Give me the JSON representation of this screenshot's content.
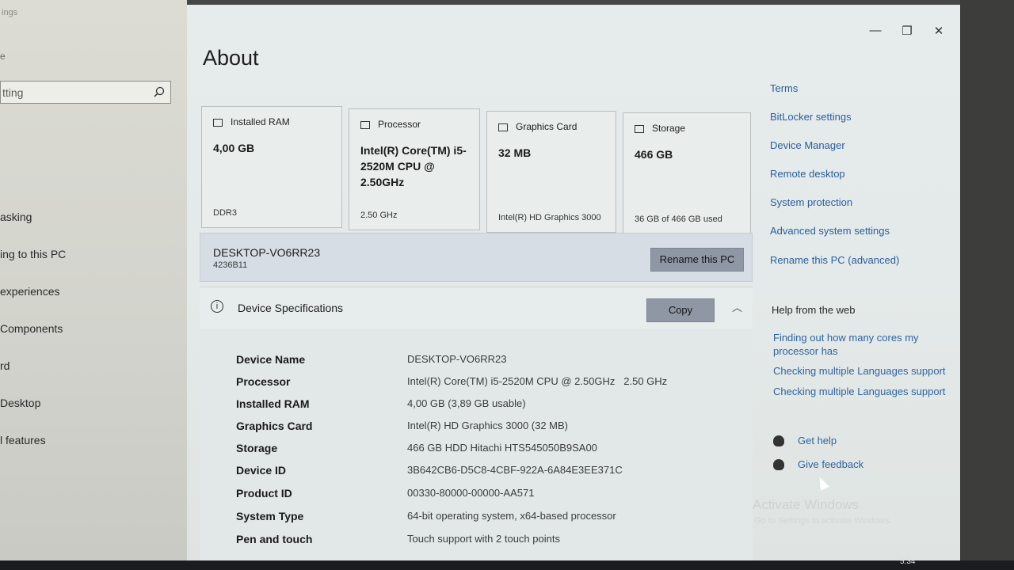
{
  "left": {
    "title": "ings",
    "back": "e",
    "search_value": "tting",
    "nav": [
      "asking",
      "ing to this PC",
      "experiences",
      "Components",
      "rd",
      "Desktop",
      "l features"
    ]
  },
  "window": {
    "minimize": "—",
    "maximize": "❐",
    "close": "✕"
  },
  "page_title": "About",
  "cards": [
    {
      "label": "Installed RAM",
      "value": "4,00 GB",
      "footer": "DDR3"
    },
    {
      "label": "Processor",
      "value": "Intel(R) Core(TM) i5-2520M CPU @ 2.50GHz",
      "footer": "2.50 GHz"
    },
    {
      "label": "Graphics Card",
      "value": "32 MB",
      "footer": "Intel(R) HD Graphics 3000"
    },
    {
      "label": "Storage",
      "value": "466 GB",
      "footer": "36 GB of 466 GB used"
    }
  ],
  "pc": {
    "name": "DESKTOP-VO6RR23",
    "id": "4236B11",
    "rename_label": "Rename this PC"
  },
  "specs": {
    "title": "Device Specifications",
    "copy_label": "Copy",
    "rows": [
      {
        "label": "Device Name",
        "value": "DESKTOP-VO6RR23"
      },
      {
        "label": "Processor",
        "value": "Intel(R) Core(TM) i5-2520M CPU @ 2.50GHz   2.50 GHz"
      },
      {
        "label": "Installed RAM",
        "value": "4,00 GB (3,89 GB usable)"
      },
      {
        "label": "Graphics Card",
        "value": "Intel(R) HD Graphics 3000 (32 MB)"
      },
      {
        "label": "Storage",
        "value": "466 GB HDD Hitachi HTS545050B9SA00"
      },
      {
        "label": "Device ID",
        "value": "3B642CB6-D5C8-4CBF-922A-6A84E3EE371C"
      },
      {
        "label": "Product ID",
        "value": "00330-80000-00000-AA571"
      },
      {
        "label": "System Type",
        "value": "64-bit operating system, x64-based processor"
      },
      {
        "label": "Pen and touch",
        "value": "Touch support with 2 touch points"
      }
    ]
  },
  "related_links": [
    "Terms",
    "BitLocker settings",
    "Device Manager",
    "Remote desktop",
    "System protection",
    "Advanced system settings",
    "Rename this PC (advanced)"
  ],
  "help": {
    "heading": "Help from the web",
    "links": [
      "Finding out how many cores my processor has",
      "Checking multiple Languages support",
      "Checking multiple Languages support"
    ]
  },
  "actions": {
    "get_help": "Get help",
    "give_feedback": "Give feedback"
  },
  "watermark": {
    "title": "Activate Windows",
    "subtitle": "Go to Settings to activate Windows."
  },
  "taskbar": {
    "time": "5:34"
  }
}
